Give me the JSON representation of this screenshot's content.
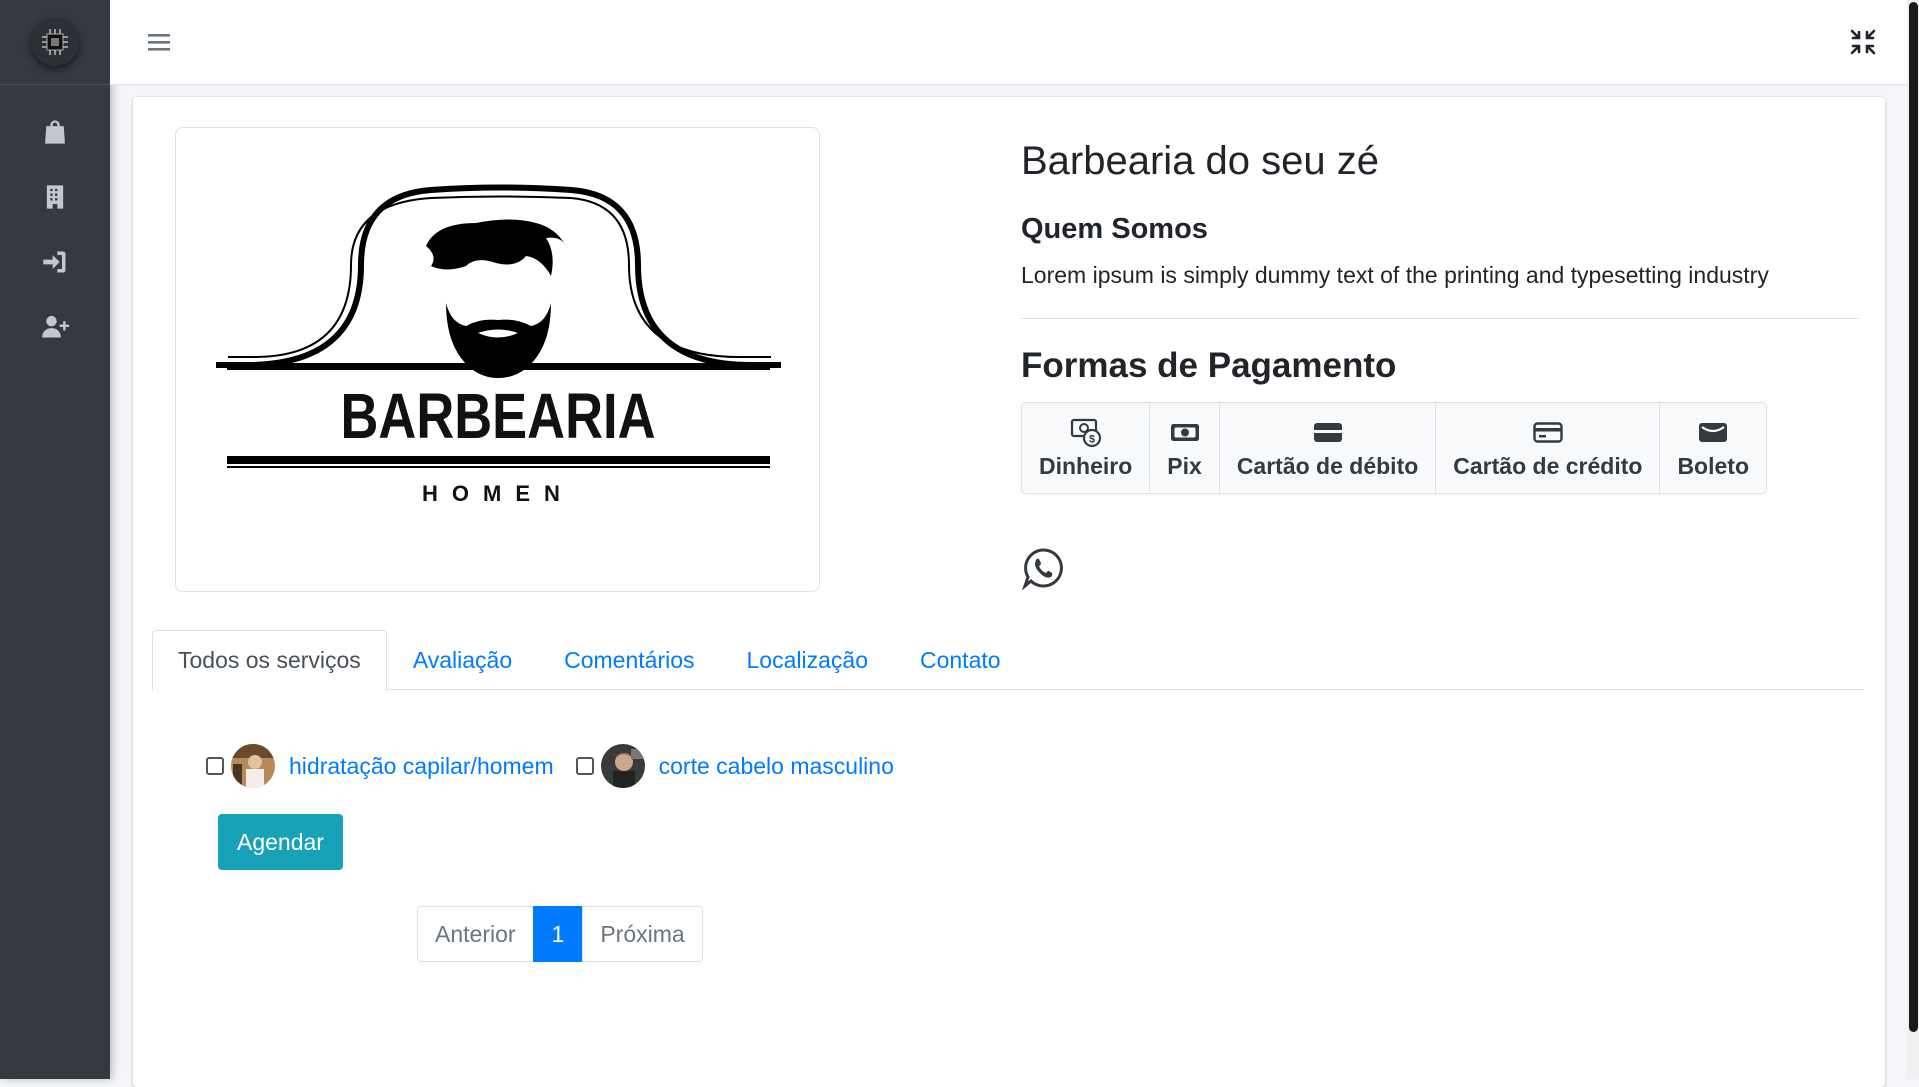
{
  "shop": {
    "name": "Barbearia do seu zé",
    "about_heading": "Quem Somos",
    "about_text": "Lorem ipsum is simply dummy text of the printing and typesetting industry",
    "payment_heading": "Formas de Pagamento",
    "logo": {
      "wordmark": "BARBEARIA",
      "subtitle": "HOMEN"
    }
  },
  "payments": [
    {
      "label": "Dinheiro",
      "icon": "money-icon"
    },
    {
      "label": "Pix",
      "icon": "banknote-icon"
    },
    {
      "label": "Cartão de débito",
      "icon": "debit-card-icon"
    },
    {
      "label": "Cartão de crédito",
      "icon": "credit-card-icon"
    },
    {
      "label": "Boleto",
      "icon": "wallet-icon"
    }
  ],
  "tabs": [
    {
      "label": "Todos os serviços",
      "active": true
    },
    {
      "label": "Avaliação"
    },
    {
      "label": "Comentários"
    },
    {
      "label": "Localização"
    },
    {
      "label": "Contato"
    }
  ],
  "services": [
    {
      "name": "hidratação capilar/homem",
      "checked": false
    },
    {
      "name": "corte cabelo masculino",
      "checked": false
    }
  ],
  "actions": {
    "schedule": "Agendar"
  },
  "pagination": {
    "prev": "Anterior",
    "current": "1",
    "next": "Próxima"
  },
  "colors": {
    "sidebar": "#343a40",
    "link": "#007bff",
    "button": "#17a2b8",
    "page_active": "#007bff"
  },
  "sidebar_icons": [
    "shopping-bag-icon",
    "building-icon",
    "sign-in-icon",
    "user-plus-icon"
  ]
}
